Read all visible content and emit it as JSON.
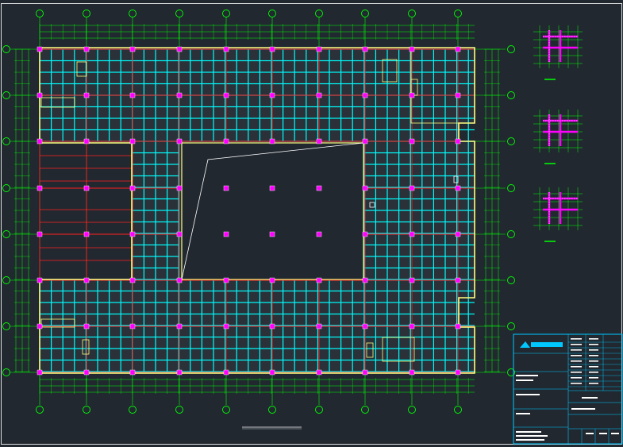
{
  "drawing": {
    "title": "",
    "scale": ""
  },
  "axes": {
    "columns": [
      "",
      "",
      "",
      "",
      "",
      "",
      "",
      "",
      "",
      ""
    ],
    "rows": [
      "",
      "",
      "",
      "",
      "",
      "",
      "",
      ""
    ]
  },
  "details": [
    {
      "label": ""
    },
    {
      "label": ""
    },
    {
      "label": ""
    }
  ],
  "title_block": {
    "company_logo": "",
    "drawing_name": "",
    "rows": [
      "",
      "",
      "",
      "",
      "",
      "",
      "",
      "",
      "",
      ""
    ]
  },
  "colors": {
    "background": "#212830",
    "grid": "#00ff00",
    "beam": "#00ffff",
    "girder": "#ff2020",
    "wall": "#ffff80",
    "column": "#ff00ff",
    "title_block": "#00c8ff"
  }
}
